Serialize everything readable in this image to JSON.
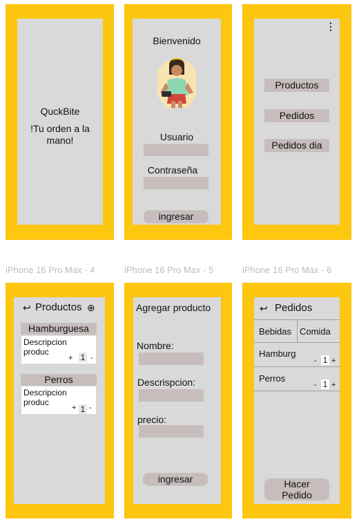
{
  "frames": {
    "f4_label": "iPhone 16 Pro Max - 4",
    "f5_label": "iPhone 16 Pro Max - 5",
    "f6_label": "iPhone 16 Pro Max - 6"
  },
  "splash": {
    "app_name": "QuckBite",
    "tagline_line1": "!Tu orden a la",
    "tagline_line2": "mano!"
  },
  "login": {
    "title": "Bienvenido",
    "user_label": "Usuario",
    "password_label": "Contraseña",
    "submit_label": "ingresar"
  },
  "menu": {
    "more_icon": "⋮",
    "items": [
      "Productos",
      "Pedidos",
      "Pedidos dia"
    ]
  },
  "products": {
    "back_icon": "↩",
    "title": "Productos",
    "add_icon": "⊕",
    "cards": [
      {
        "name": "Hamburguesa",
        "desc_line1": "Descripcion",
        "desc_line2": "produc",
        "plus": "+",
        "qty": "1",
        "minus": "-"
      },
      {
        "name": "Perros",
        "desc_line1": "Descripcion",
        "desc_line2": "produc",
        "plus": "+",
        "qty": "1",
        "minus": "-"
      }
    ]
  },
  "add_product": {
    "title": "Agregar producto",
    "name_label": "Nombre:",
    "desc_label": "Descrispcion:",
    "price_label": "precio:",
    "submit_label": "ingresar"
  },
  "orders": {
    "back_icon": "↩",
    "title": "Pedidos",
    "tabs": [
      "Bebidas",
      "Comida"
    ],
    "rows": [
      {
        "name": "Hamburg",
        "minus": "-",
        "qty": "1",
        "plus": "+"
      },
      {
        "name": "Perros",
        "minus": "-",
        "qty": "1",
        "plus": "+"
      }
    ],
    "submit_line1": "Hacer",
    "submit_line2": "Pedido"
  }
}
